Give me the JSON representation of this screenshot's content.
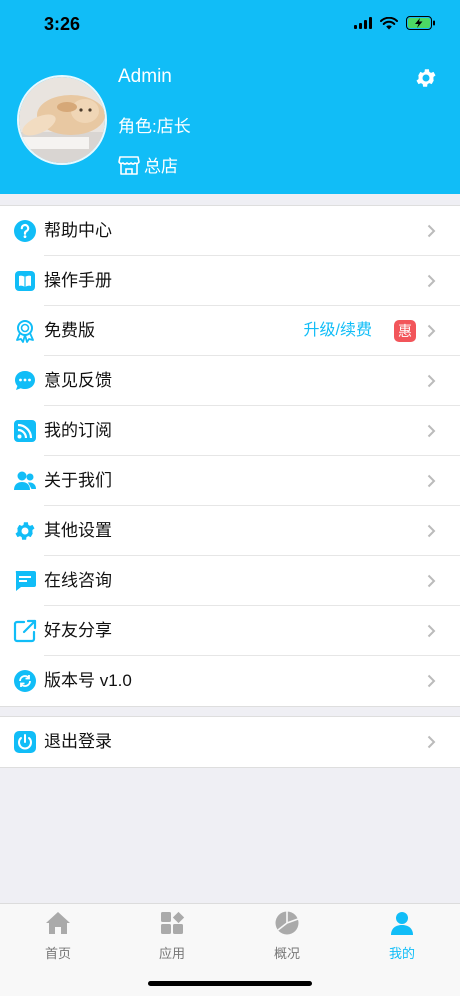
{
  "status_bar": {
    "time": "3:26"
  },
  "profile": {
    "username": "Admin",
    "role": "角色:店长",
    "store": "总店"
  },
  "menu": [
    {
      "label": "帮助中心",
      "icon": "help-icon"
    },
    {
      "label": "操作手册",
      "icon": "manual-icon"
    },
    {
      "label": "免费版",
      "icon": "badge-icon",
      "action_text": "升级/续费",
      "badge": "惠"
    },
    {
      "label": "意见反馈",
      "icon": "feedback-icon"
    },
    {
      "label": "我的订阅",
      "icon": "rss-icon"
    },
    {
      "label": "关于我们",
      "icon": "about-us-icon"
    },
    {
      "label": "其他设置",
      "icon": "settings-icon"
    },
    {
      "label": "在线咨询",
      "icon": "chat-icon"
    },
    {
      "label": "好友分享",
      "icon": "share-icon"
    },
    {
      "label": "版本号 v1.0",
      "icon": "refresh-icon"
    }
  ],
  "logout": {
    "label": "退出登录",
    "icon": "power-icon"
  },
  "tabbar": [
    {
      "label": "首页",
      "icon": "home-icon",
      "active": false
    },
    {
      "label": "应用",
      "icon": "apps-icon",
      "active": false
    },
    {
      "label": "概况",
      "icon": "pie-chart-icon",
      "active": false
    },
    {
      "label": "我的",
      "icon": "user-icon",
      "active": true
    }
  ],
  "colors": {
    "accent": "#11bdf7",
    "badge": "#f2555a",
    "inactive": "#aaaaaa"
  }
}
